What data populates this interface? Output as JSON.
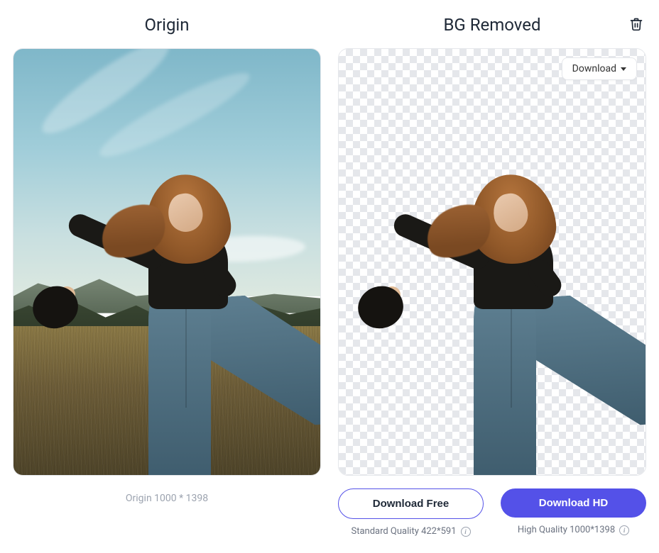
{
  "panels": {
    "origin": {
      "title": "Origin",
      "caption": "Origin 1000 * 1398"
    },
    "removed": {
      "title": "BG Removed",
      "download_menu_label": "Download"
    }
  },
  "actions": {
    "free": {
      "button": "Download Free",
      "quality": "Standard Quality 422*591"
    },
    "hd": {
      "button": "Download HD",
      "quality": "High Quality 1000*1398"
    }
  },
  "icons": {
    "trash": "trash-icon",
    "info": "i",
    "caret": "caret-down-icon"
  }
}
